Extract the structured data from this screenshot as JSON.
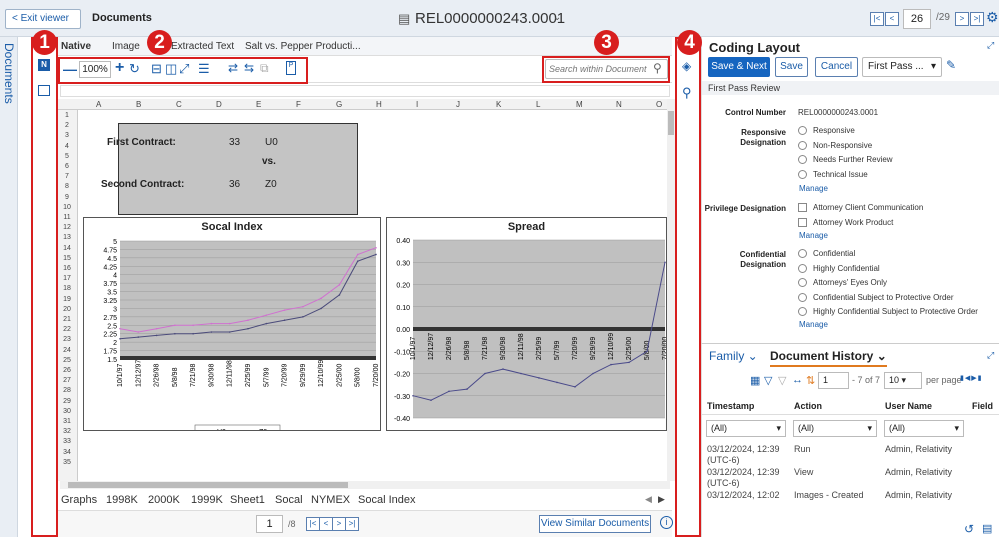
{
  "header": {
    "exit_label": "< Exit viewer",
    "crumb": "Documents",
    "title": "REL0000000243.0001",
    "page_current": "26",
    "page_total": "/29"
  },
  "left": {
    "docs_label": "Documents"
  },
  "viewer": {
    "tabs": [
      "Native",
      "Image",
      "Extracted Text",
      "Salt vs. Pepper Producti..."
    ],
    "zoom": "100%",
    "search_placeholder": "Search within Document",
    "columns": [
      "A",
      "B",
      "C",
      "D",
      "E",
      "F",
      "G",
      "H",
      "I",
      "J",
      "K",
      "L",
      "M",
      "N",
      "O"
    ],
    "rows": [
      "1",
      "2",
      "3",
      "4",
      "5",
      "6",
      "7",
      "8",
      "9",
      "10",
      "11",
      "12",
      "13",
      "14",
      "15",
      "16",
      "17",
      "18",
      "19",
      "20",
      "21",
      "22",
      "23",
      "24",
      "25",
      "26",
      "27",
      "28",
      "29",
      "30",
      "31",
      "32",
      "33",
      "34",
      "35"
    ],
    "cells": {
      "first": "First Contract:",
      "first_num": "33",
      "first_code": "U0",
      "vs": "vs.",
      "second": "Second Contract:",
      "second_num": "36",
      "second_code": "Z0"
    },
    "sheet_tabs": [
      "Graphs",
      "1998K",
      "2000K",
      "1999K",
      "Sheet1",
      "Socal",
      "NYMEX",
      "Socal Index"
    ],
    "sheet_page": "1",
    "sheet_total": "/8",
    "similar_label": "View Similar Documents"
  },
  "chart_data": [
    {
      "type": "line",
      "title": "Socal Index",
      "x": [
        "10/1/97",
        "12/12/97",
        "2/26/98",
        "5/8/98",
        "7/21/98",
        "9/30/98",
        "12/11/98",
        "2/25/99",
        "5/7/99",
        "7/20/99",
        "9/29/99",
        "12/10/99",
        "2/25/00",
        "5/8/00",
        "7/20/00"
      ],
      "yticks": [
        "5",
        "4.75",
        "4.5",
        "4.25",
        "4",
        "3.75",
        "3.5",
        "3.25",
        "3",
        "2.75",
        "2.5",
        "2.25",
        "2",
        "1.75",
        "1.5"
      ],
      "ylim": [
        1.5,
        5
      ],
      "series": [
        {
          "name": "U0",
          "values": [
            2.1,
            2.15,
            2.2,
            2.25,
            2.25,
            2.3,
            2.3,
            2.4,
            2.55,
            2.65,
            2.75,
            3.0,
            3.4,
            4.4,
            4.6
          ]
        },
        {
          "name": "Z0",
          "values": [
            2.4,
            2.3,
            2.4,
            2.5,
            2.5,
            2.55,
            2.55,
            2.65,
            2.8,
            2.95,
            3.05,
            3.3,
            3.7,
            4.6,
            4.8
          ]
        }
      ]
    },
    {
      "type": "line",
      "title": "Spread",
      "x": [
        "10/1/97",
        "12/12/97",
        "2/26/98",
        "5/8/98",
        "7/21/98",
        "9/30/98",
        "12/11/98",
        "2/25/99",
        "5/7/99",
        "7/20/99",
        "9/29/99",
        "12/10/99",
        "2/25/00",
        "5/8/00",
        "7/20/00"
      ],
      "yticks": [
        "0.40",
        "0.30",
        "0.20",
        "0.10",
        "0.00",
        "-0.10",
        "-0.20",
        "-0.30",
        "-0.40"
      ],
      "ylim": [
        -0.4,
        0.4
      ],
      "series": [
        {
          "values": [
            -0.3,
            -0.32,
            -0.28,
            -0.27,
            -0.2,
            -0.18,
            -0.2,
            -0.22,
            -0.24,
            -0.26,
            -0.2,
            -0.16,
            -0.15,
            -0.1,
            0.3
          ]
        }
      ]
    }
  ],
  "coding": {
    "title": "Coding Layout",
    "save_next": "Save & Next",
    "save": "Save",
    "cancel": "Cancel",
    "profile": "First Pass ...",
    "section": "First Pass Review",
    "control_label": "Control Number",
    "control_value": "REL0000000243.0001",
    "responsive_label": "Responsive Designation",
    "responsive_opts": [
      "Responsive",
      "Non-Responsive",
      "Needs Further Review",
      "Technical Issue"
    ],
    "privilege_label": "Privilege Designation",
    "privilege_opts": [
      "Attorney Client Communication",
      "Attorney Work Product"
    ],
    "confidential_label": "Confidential Designation",
    "confidential_opts": [
      "Confidential",
      "Highly Confidential",
      "Attorneys' Eyes Only",
      "Confidential Subject to Protective Order",
      "Highly Confidential Subject to Protective Order"
    ],
    "manage": "Manage"
  },
  "history": {
    "tab_family": "Family",
    "tab_history": "Document History",
    "page_current": "1",
    "page_info": "- 7 of 7",
    "per_page": "10",
    "per_page_label": "per page",
    "headers": [
      "Timestamp",
      "Action",
      "User Name",
      "Field"
    ],
    "filter": "(All)",
    "rows": [
      [
        "03/12/2024, 12:39 (UTC-6)",
        "Run",
        "Admin, Relativity"
      ],
      [
        "03/12/2024, 12:39 (UTC-6)",
        "View",
        "Admin, Relativity"
      ],
      [
        "03/12/2024, 12:02",
        "Images - Created",
        "Admin, Relativity"
      ]
    ]
  },
  "markers": [
    "1",
    "2",
    "3",
    "4"
  ]
}
